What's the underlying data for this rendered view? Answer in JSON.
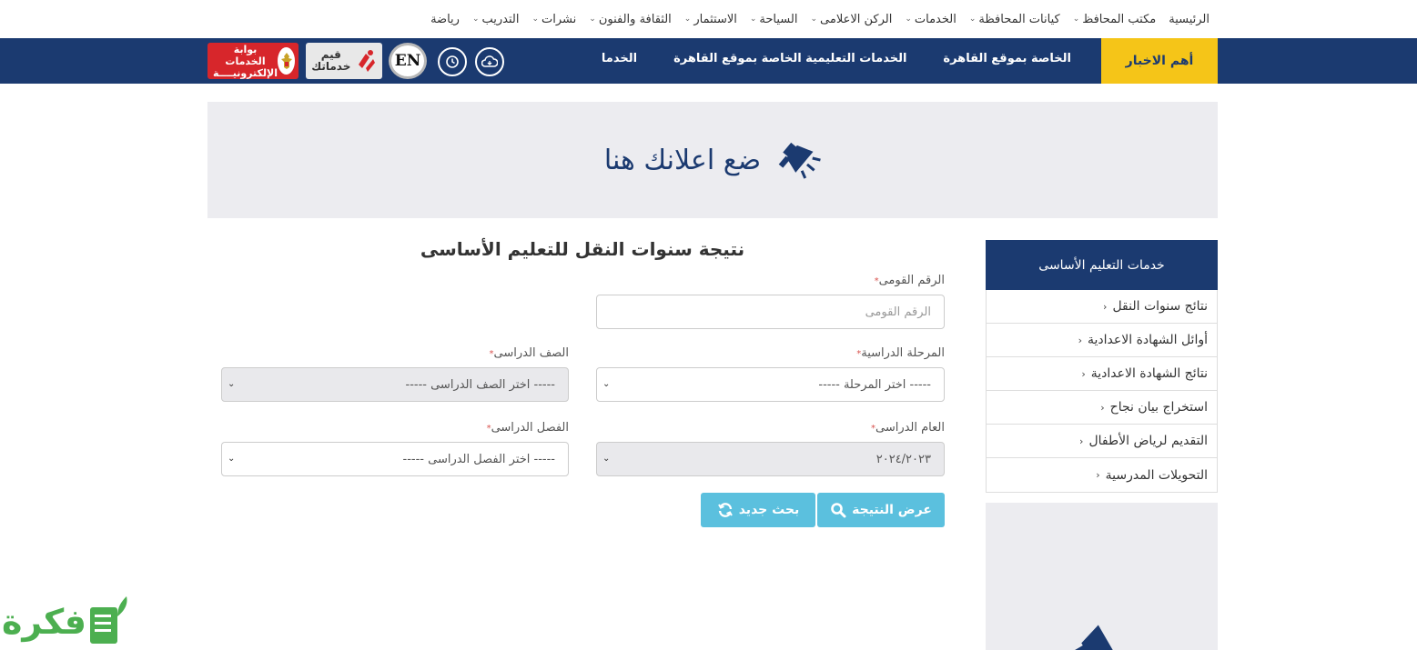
{
  "topnav": {
    "items": [
      {
        "label": "الرئيسية",
        "dropdown": false
      },
      {
        "label": "مكتب المحافظ",
        "dropdown": true
      },
      {
        "label": "كيانات المحافظة",
        "dropdown": true
      },
      {
        "label": "الخدمات",
        "dropdown": true
      },
      {
        "label": "الركن الاعلامى",
        "dropdown": true
      },
      {
        "label": "السياحة",
        "dropdown": true
      },
      {
        "label": "الاستثمار",
        "dropdown": true
      },
      {
        "label": "الثقافة والفنون",
        "dropdown": true
      },
      {
        "label": "نشرات",
        "dropdown": true
      },
      {
        "label": "التدريب",
        "dropdown": true
      },
      {
        "label": "رياضة",
        "dropdown": false
      }
    ]
  },
  "bluebar": {
    "news_label": "أهم الاخبار",
    "ticker": [
      "الخاصة بموقع القاهرة",
      "الخدمات التعليمية الخاصة بموقع القاهرة",
      "الخدما"
    ],
    "en_label": "EN",
    "qiyam_label_1": "قيم",
    "qiyam_label_2": "خدماتك",
    "egov_label_1": "بوابة الخدمات",
    "egov_label_2": "الإلكترونيــــة"
  },
  "ad": {
    "text": "ضع اعلانك هنا"
  },
  "form": {
    "title": "نتيجة سنوات النقل للتعليم الأساسى",
    "national_id_label": "الرقم القومى",
    "national_id_placeholder": "الرقم القومى",
    "stage_label": "المرحلة الدراسية",
    "stage_value": "----- اختر المرحلة -----",
    "grade_label": "الصف الدراسى",
    "grade_value": "----- اختر الصف الدراسى -----",
    "year_label": "العام الدراسى",
    "year_value": "٢٠٢٤/٢٠٢٣",
    "term_label": "الفصل الدراسى",
    "term_value": "----- اختر الفصل الدراسى -----",
    "required_mark": "*",
    "show_result_label": "عرض النتيجة",
    "new_search_label": "بحث جديد"
  },
  "sidebar": {
    "title": "خدمات التعليم الأساسى",
    "items": [
      "نتائج سنوات النقل",
      "أوائل الشهادة الاعدادية",
      "نتائج الشهادة الاعدادية",
      "استخراج بيان نجاح",
      "التقديم لرياض الأطفال",
      "التحويلات المدرسية"
    ]
  },
  "watermark": {
    "text": "فكرة"
  },
  "colors": {
    "navy": "#1b3a70",
    "yellow": "#f5c518",
    "button": "#5bc0de",
    "red": "#d7262b",
    "green": "#4caf50"
  }
}
